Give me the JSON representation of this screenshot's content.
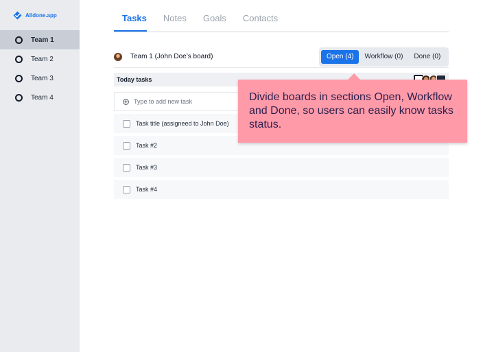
{
  "brand": {
    "name": "Alldone.app"
  },
  "sidebar": {
    "items": [
      {
        "label": "Team 1",
        "active": true
      },
      {
        "label": "Team 2",
        "active": false
      },
      {
        "label": "Team 3",
        "active": false
      },
      {
        "label": "Team 4",
        "active": false
      }
    ]
  },
  "tabs": [
    {
      "label": "Tasks",
      "active": true
    },
    {
      "label": "Notes",
      "active": false
    },
    {
      "label": "Goals",
      "active": false
    },
    {
      "label": "Contacts",
      "active": false
    }
  ],
  "board": {
    "title": "Team 1 (John Doe’s board)",
    "segments": [
      {
        "label": "Open (4)",
        "active": true
      },
      {
        "label": "Workflow (0)",
        "active": false
      },
      {
        "label": "Done (0)",
        "active": false
      }
    ]
  },
  "section": {
    "title": "Today tasks",
    "add_placeholder": "Type to add new task",
    "tasks": [
      {
        "title": "Task title (assigneed to John Doe)"
      },
      {
        "title": "Task #2"
      },
      {
        "title": "Task #3"
      },
      {
        "title": "Task #4"
      }
    ]
  },
  "callout": {
    "text": "Divide boards in sections Open, Workflow and Done, so users can easily know tasks status."
  },
  "colors": {
    "accent": "#1a73e8",
    "sidebar_bg": "#e9ebef",
    "callout_bg": "#ff9aa8"
  }
}
